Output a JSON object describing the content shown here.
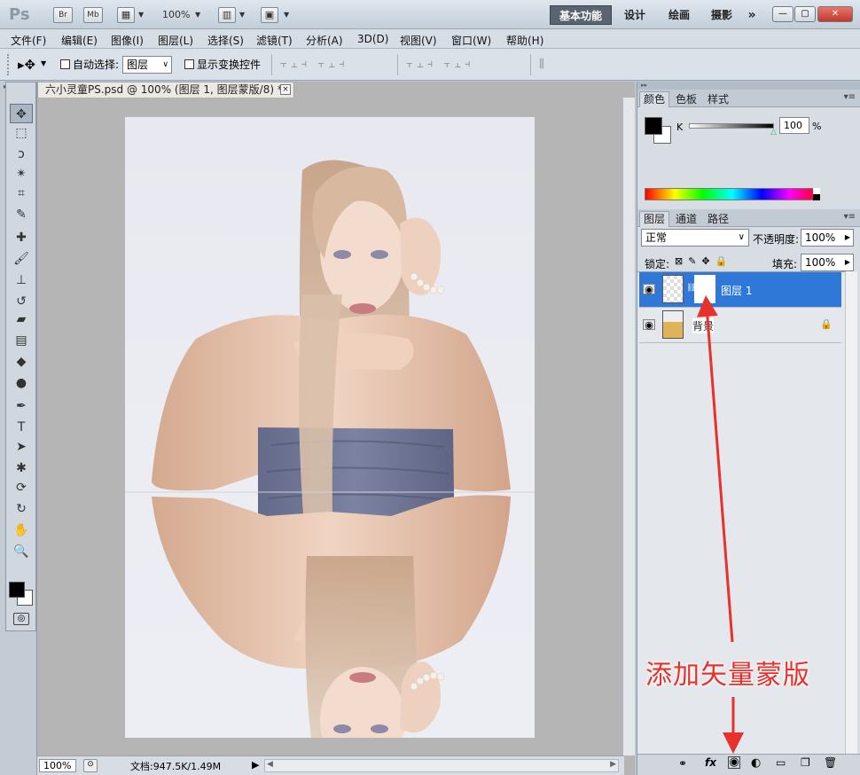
{
  "titlebar": {
    "logo": "Ps",
    "br_label": "Br",
    "mb_label": "Mb",
    "zoom": "100%",
    "workspaces": [
      {
        "label": "基本功能",
        "active": true
      },
      {
        "label": "设计",
        "active": false
      },
      {
        "label": "绘画",
        "active": false
      },
      {
        "label": "摄影",
        "active": false
      }
    ],
    "more": "»",
    "window_controls": {
      "minimize": "—",
      "restore": "▢",
      "close": "✕"
    }
  },
  "menubar": [
    "文件(F)",
    "编辑(E)",
    "图像(I)",
    "图层(L)",
    "选择(S)",
    "滤镜(T)",
    "分析(A)",
    "3D(D)",
    "视图(V)",
    "窗口(W)",
    "帮助(H)"
  ],
  "options": {
    "tool_icon": "move-tool-icon",
    "auto_select_label": "自动选择:",
    "auto_select_checked": false,
    "auto_select_value": "图层",
    "show_transform_label": "显示变换控件",
    "show_transform_checked": false
  },
  "document": {
    "tab_title": "六小灵童PS.psd @ 100% (图层 1, 图层蒙版/8) *",
    "tab_close": "×",
    "status_zoom": "100%",
    "status_doc": "文档:947.5K/1.49M",
    "status_arrow": "▶",
    "scroll_left": "◀",
    "scroll_right": "▶"
  },
  "tools": [
    {
      "name": "move-tool-icon",
      "glyph": "✥",
      "active": true
    },
    {
      "name": "marquee-tool-icon",
      "glyph": "⬚"
    },
    {
      "name": "lasso-tool-icon",
      "glyph": "ↄ"
    },
    {
      "name": "magic-wand-tool-icon",
      "glyph": "✴"
    },
    {
      "name": "crop-tool-icon",
      "glyph": "⌗"
    },
    {
      "name": "eyedropper-tool-icon",
      "glyph": "✎"
    },
    {
      "name": "healing-brush-tool-icon",
      "glyph": "✚"
    },
    {
      "name": "brush-tool-icon",
      "glyph": "🖌"
    },
    {
      "name": "clone-stamp-tool-icon",
      "glyph": "⊥"
    },
    {
      "name": "history-brush-tool-icon",
      "glyph": "↺"
    },
    {
      "name": "eraser-tool-icon",
      "glyph": "▰"
    },
    {
      "name": "gradient-tool-icon",
      "glyph": "▤"
    },
    {
      "name": "blur-tool-icon",
      "glyph": "◆"
    },
    {
      "name": "dodge-tool-icon",
      "glyph": "●"
    },
    {
      "name": "pen-tool-icon",
      "glyph": "✒"
    },
    {
      "name": "type-tool-icon",
      "glyph": "T"
    },
    {
      "name": "path-selection-tool-icon",
      "glyph": "➤"
    },
    {
      "name": "shape-tool-icon",
      "glyph": "✱"
    },
    {
      "name": "3d-rotate-tool-icon",
      "glyph": "⟳"
    },
    {
      "name": "3d-orbit-tool-icon",
      "glyph": "↻"
    },
    {
      "name": "hand-tool-icon",
      "glyph": "✋"
    },
    {
      "name": "zoom-tool-icon",
      "glyph": "🔍"
    }
  ],
  "color_panel": {
    "tabs": [
      {
        "label": "颜色",
        "active": true
      },
      {
        "label": "色板",
        "active": false
      },
      {
        "label": "样式",
        "active": false
      }
    ],
    "channel_label": "K",
    "value": "100",
    "unit": "%",
    "foreground": "#000000",
    "background": "#ffffff"
  },
  "layers_panel": {
    "tabs": [
      {
        "label": "图层",
        "active": true
      },
      {
        "label": "通道",
        "active": false
      },
      {
        "label": "路径",
        "active": false
      }
    ],
    "blend_mode": "正常",
    "opacity_label": "不透明度:",
    "opacity": "100%",
    "lock_label": "锁定:",
    "fill_label": "填充:",
    "fill": "100%",
    "layers": [
      {
        "name": "图层 1",
        "selected": true,
        "has_mask": true,
        "visible": true
      },
      {
        "name": "背景",
        "selected": false,
        "has_mask": false,
        "visible": true,
        "locked": true
      }
    ],
    "bottom_icons": [
      "link-layers-icon",
      "fx-icon",
      "add-mask-icon",
      "adjustment-layer-icon",
      "new-group-icon",
      "new-layer-icon",
      "delete-layer-icon"
    ]
  },
  "annotation": {
    "text": "添加矢量蒙版",
    "color": "#e8302c"
  }
}
